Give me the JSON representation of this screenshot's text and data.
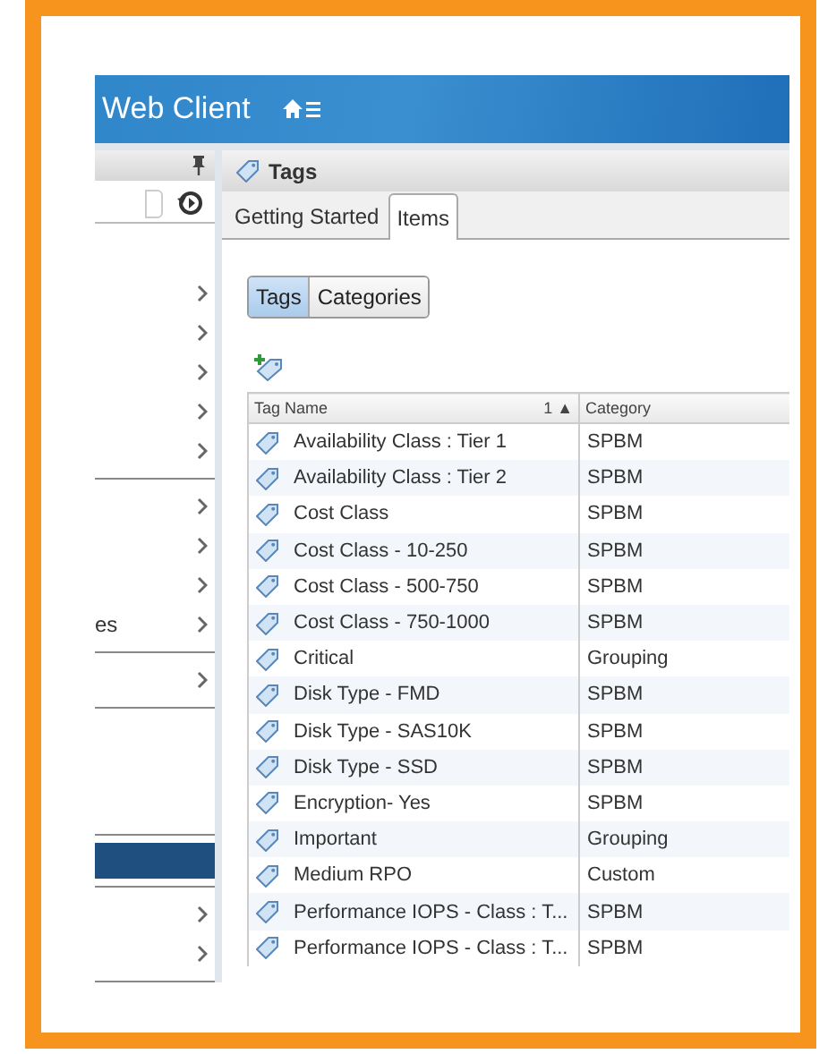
{
  "header": {
    "title": "Web Client"
  },
  "sidebar": {
    "sections": [
      [
        {
          "selected": false
        },
        {
          "selected": false
        },
        {
          "selected": false
        },
        {
          "selected": false
        },
        {
          "selected": false
        }
      ],
      [
        {
          "selected": false
        },
        {
          "selected": false
        },
        {
          "selected": false
        },
        {
          "selected": false,
          "label": "es"
        }
      ],
      [
        {
          "selected": false
        }
      ],
      [
        {
          "selected": true,
          "chevron": false
        }
      ],
      [
        {
          "selected": false
        },
        {
          "selected": false
        }
      ]
    ]
  },
  "panel": {
    "title": "Tags"
  },
  "tabs": [
    {
      "label": "Getting Started",
      "selected": false
    },
    {
      "label": "Items",
      "selected": true
    }
  ],
  "toggle": [
    {
      "label": "Tags",
      "selected": true
    },
    {
      "label": "Categories",
      "selected": false
    }
  ],
  "table": {
    "columns": [
      {
        "label": "Tag Name",
        "sort": "1 ▲"
      },
      {
        "label": "Category"
      }
    ],
    "rows": [
      {
        "name": "Availability Class : Tier 1",
        "category": "SPBM"
      },
      {
        "name": "Availability Class : Tier 2",
        "category": "SPBM"
      },
      {
        "name": "Cost Class",
        "category": "SPBM"
      },
      {
        "name": "Cost Class - 10-250",
        "category": "SPBM"
      },
      {
        "name": "Cost Class - 500-750",
        "category": "SPBM"
      },
      {
        "name": "Cost Class - 750-1000",
        "category": "SPBM"
      },
      {
        "name": "Critical",
        "category": "Grouping"
      },
      {
        "name": "Disk Type - FMD",
        "category": "SPBM"
      },
      {
        "name": "Disk Type - SAS10K",
        "category": "SPBM"
      },
      {
        "name": "Disk Type - SSD",
        "category": "SPBM"
      },
      {
        "name": "Encryption- Yes",
        "category": "SPBM"
      },
      {
        "name": "Important",
        "category": "Grouping"
      },
      {
        "name": "Medium RPO",
        "category": "Custom"
      },
      {
        "name": "Performance IOPS - Class : T...",
        "category": "SPBM"
      },
      {
        "name": "Performance IOPS - Class : T...",
        "category": "SPBM"
      }
    ]
  }
}
